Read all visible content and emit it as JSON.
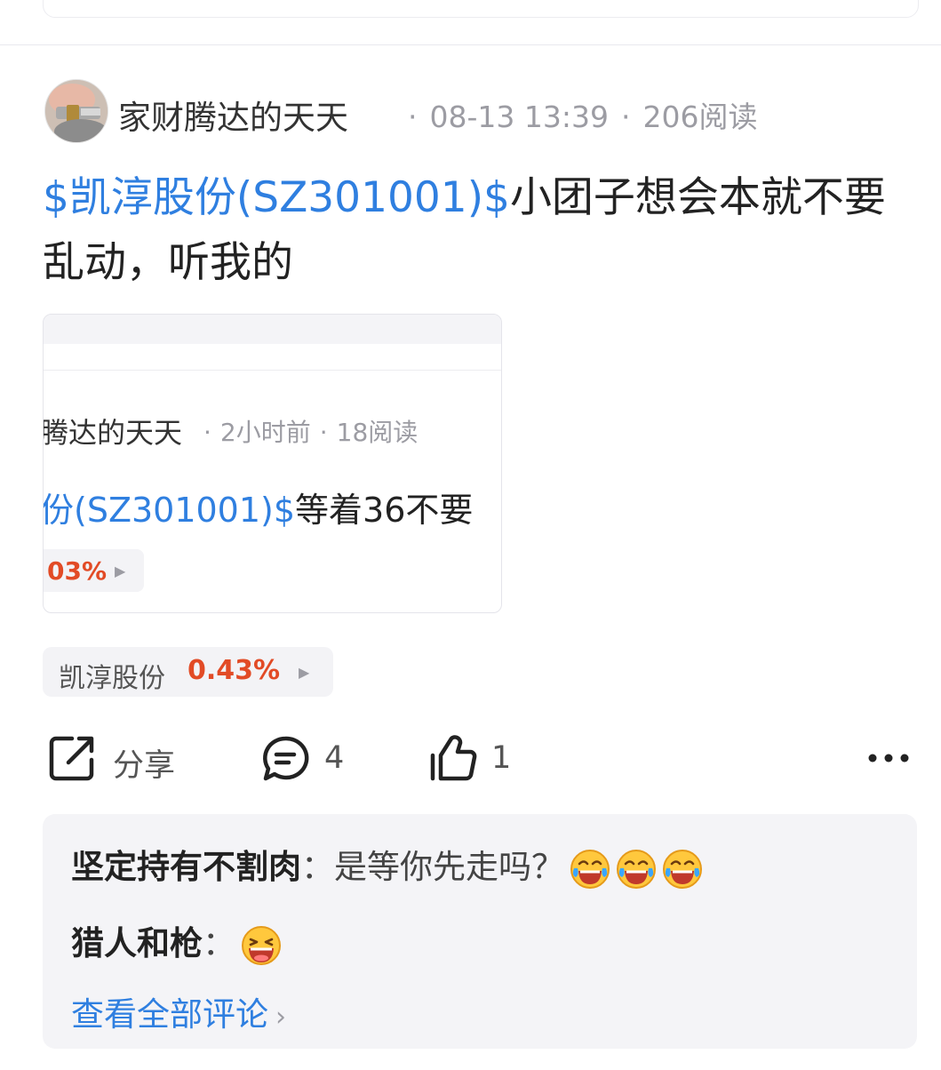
{
  "post": {
    "author": "家财腾达的天天",
    "time": "08-13 13:39",
    "reads": "206阅读",
    "stock_tag": "$凯淳股份(SZ301001)$",
    "text": "小团子想会本就不要乱动，听我的"
  },
  "quoted": {
    "author": "腾达的天天",
    "time": "2小时前",
    "reads": "18阅读",
    "stock_tag": "份(SZ301001)$",
    "text": "等着36不要",
    "chip_value": "03%"
  },
  "stock_chip": {
    "name": "凯淳股份",
    "change": "0.43%"
  },
  "actions": {
    "share_label": "分享",
    "comment_count": "4",
    "like_count": "1"
  },
  "comments": [
    {
      "name": "坚定持有不割肉",
      "sep": "：",
      "text": "是等你先走吗？",
      "emojis": [
        "laugh-cry",
        "laugh-cry",
        "laugh-cry"
      ]
    },
    {
      "name": "猎人和枪",
      "sep": "：",
      "text": "",
      "emojis": [
        "grin"
      ]
    }
  ],
  "view_all": "查看全部评论",
  "colors": {
    "link": "#2f7fe0",
    "rise": "#e24b26",
    "muted": "#9c9ca3",
    "panel": "#f4f4f7"
  }
}
